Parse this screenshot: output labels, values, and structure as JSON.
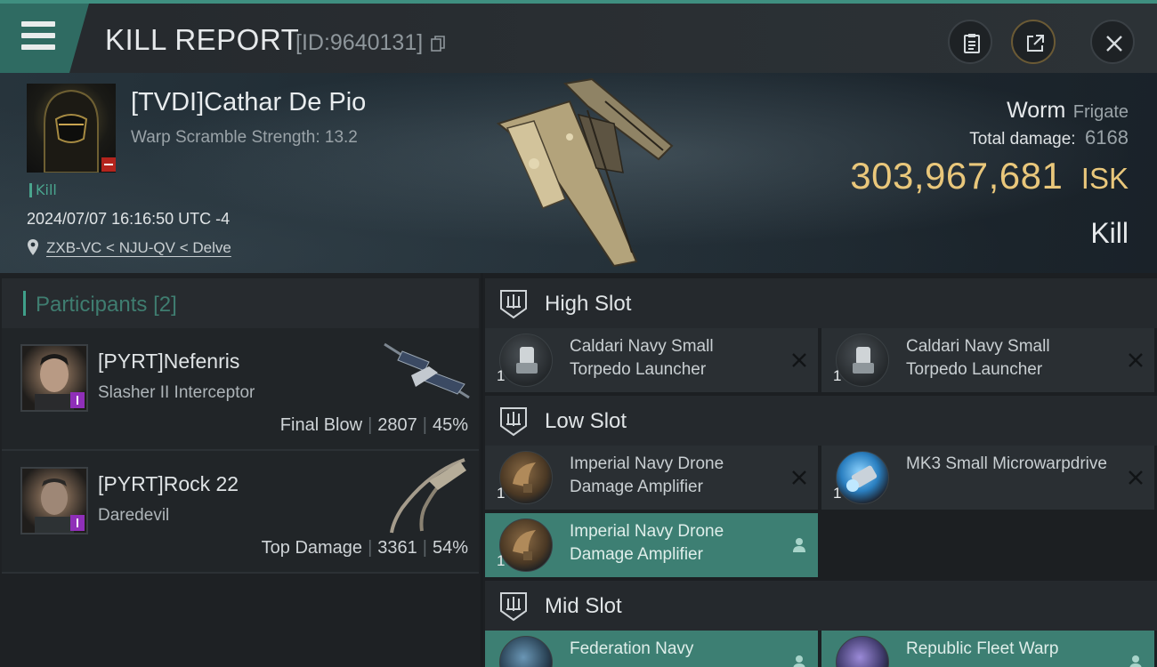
{
  "header": {
    "title": "KILL REPORT",
    "report_id": "[ID:9640131]"
  },
  "victim": {
    "name": "[TVDI]Cathar De Pio",
    "warp_scramble": "Warp Scramble Strength: 13.2",
    "kill_tag": "Kill",
    "datetime": "2024/07/07 16:16:50 UTC -4",
    "location": "ZXB-VC < NJU-QV < Delve",
    "ship_name": "Worm",
    "ship_class": "Frigate",
    "total_damage_label": "Total damage:",
    "total_damage": "6168",
    "isk_value": "303,967,681",
    "isk_unit": "ISK",
    "outcome": "Kill"
  },
  "participants": {
    "label": "Participants",
    "count": "[2]",
    "items": [
      {
        "name": "[PYRT]Nefenris",
        "ship": "Slasher II Interceptor",
        "role": "Final Blow",
        "damage": "2807",
        "percent": "45%"
      },
      {
        "name": "[PYRT]Rock 22",
        "ship": "Daredevil",
        "role": "Top Damage",
        "damage": "3361",
        "percent": "54%"
      }
    ]
  },
  "fitting": {
    "high_slot": {
      "label": "High Slot",
      "modules": [
        {
          "name": "Caldari Navy Small Torpedo Launcher",
          "qty": "1",
          "status": "destroyed"
        },
        {
          "name": "Caldari Navy Small Torpedo Launcher",
          "qty": "1",
          "status": "destroyed"
        }
      ]
    },
    "low_slot": {
      "label": "Low Slot",
      "modules": [
        {
          "name": "Imperial Navy Drone Damage Amplifier",
          "qty": "1",
          "status": "destroyed"
        },
        {
          "name": "MK3 Small Microwarpdrive",
          "qty": "1",
          "status": "destroyed"
        },
        {
          "name": "Imperial Navy Drone Damage Amplifier",
          "qty": "1",
          "status": "dropped"
        }
      ]
    },
    "mid_slot": {
      "label": "Mid Slot",
      "modules": [
        {
          "name": "Federation Navy",
          "qty": "",
          "status": "dropped"
        },
        {
          "name": "Republic Fleet Warp",
          "qty": "",
          "status": "dropped"
        }
      ]
    }
  },
  "icons": {
    "menu": "hamburger-menu-icon",
    "copy": "copy-icon",
    "clipboard": "clipboard-icon",
    "share": "share-icon",
    "close": "close-icon",
    "location": "map-pin-icon",
    "slot": "slot-icon",
    "destroyed": "x-mark-icon",
    "dropped": "person-icon"
  },
  "colors": {
    "accent": "#3f8f80",
    "isk": "#e9c77b",
    "dropped_bg": "#3d7f73",
    "kill_tag": "#4aa58e"
  }
}
